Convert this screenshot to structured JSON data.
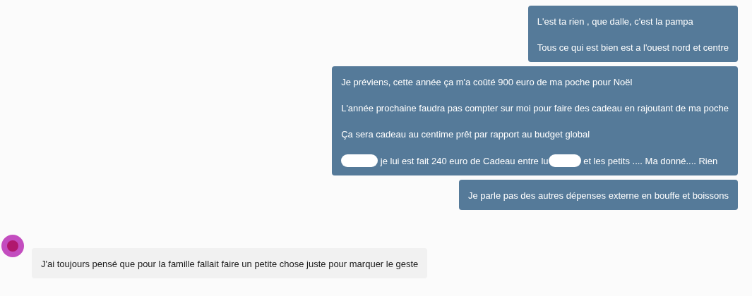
{
  "messages": [
    {
      "kind": "outgoing",
      "lines": [
        [
          {
            "kind": "text",
            "text": "L'est ta rien , que dalle, c'est la pampa"
          }
        ],
        [
          {
            "kind": "text",
            "text": "Tous ce qui est bien est a l'ouest nord et centre"
          }
        ]
      ]
    },
    {
      "kind": "outgoing",
      "lines": [
        [
          {
            "kind": "text",
            "text": "Je préviens, cette année ça m'a coûté 900 euro de ma poche pour Noël"
          }
        ],
        [
          {
            "kind": "text",
            "text": "L'année prochaine faudra pas compter sur moi pour faire des cadeau en rajoutant de ma poche"
          }
        ],
        [
          {
            "kind": "text",
            "text": "Ça sera cadeau au centime prêt par rapport au budget global"
          }
        ],
        [
          {
            "kind": "redaction"
          },
          {
            "kind": "text",
            "text": " je lui est fait 240 euro de Cadeau entre lu"
          },
          {
            "kind": "redaction"
          },
          {
            "kind": "text",
            "text": " et les petits .... Ma donné.... Rien"
          }
        ]
      ]
    },
    {
      "kind": "outgoing",
      "lines": [
        [
          {
            "kind": "text",
            "text": "Je parle pas des autres dépenses externe en bouffe et boissons"
          }
        ]
      ]
    },
    {
      "kind": "incoming",
      "lines": [
        [
          {
            "kind": "text",
            "text": "J'ai toujours pensé que pour la famille fallait faire un petite chose juste pour marquer le geste"
          }
        ]
      ]
    }
  ]
}
